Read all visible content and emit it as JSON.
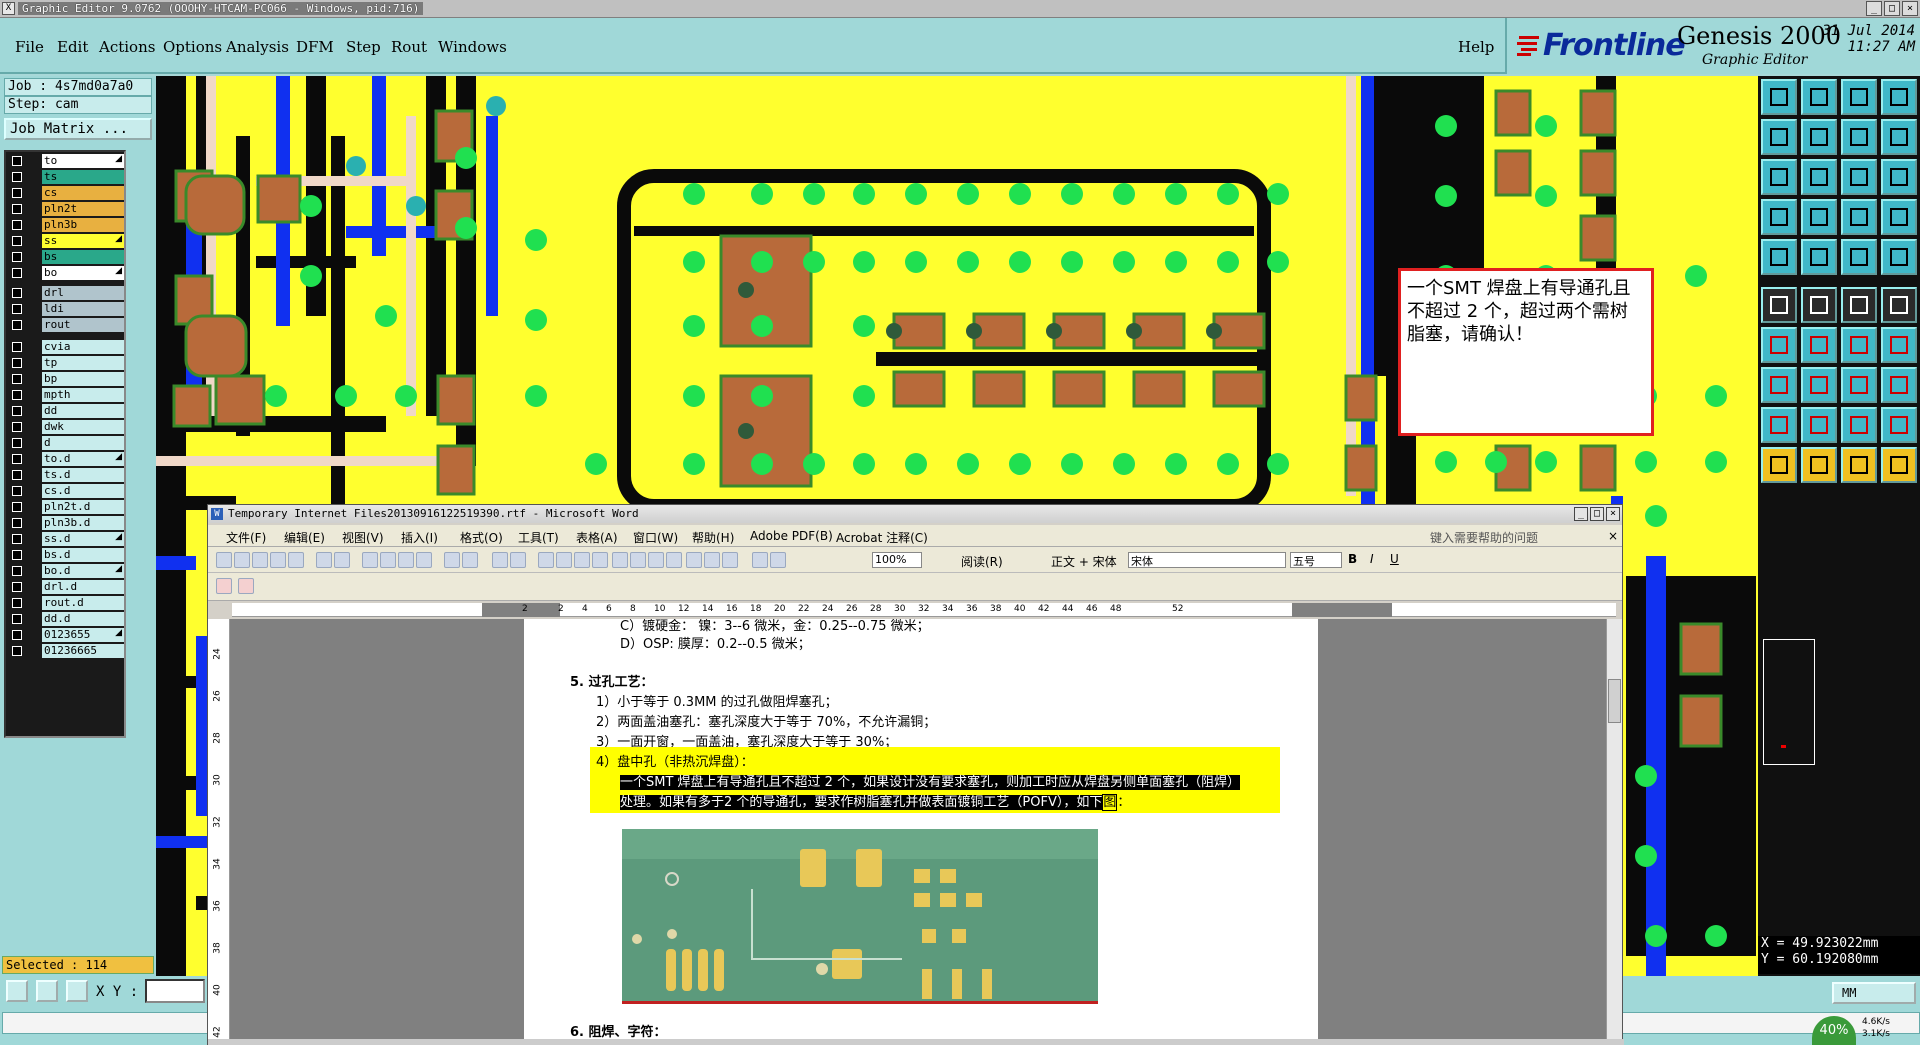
{
  "titlebar": {
    "title": "Graphic Editor 9.0762 (OOOHY-HTCAM-PC066 - Windows, pid:716)"
  },
  "menu": {
    "items": [
      {
        "label": "File",
        "u": "F"
      },
      {
        "label": "Edit",
        "u": "E"
      },
      {
        "label": "Actions",
        "u": "A"
      },
      {
        "label": "Options",
        "u": "O"
      },
      {
        "label": "Analysis",
        "u": "A"
      },
      {
        "label": "DFM",
        "u": "D"
      },
      {
        "label": "Step",
        "u": "S"
      },
      {
        "label": "Rout",
        "u": "R"
      },
      {
        "label": "Windows",
        "u": "W"
      }
    ],
    "help": "Help"
  },
  "brand": {
    "logo": "Frontline",
    "product": "Genesis 2000",
    "subtitle": "Graphic Editor",
    "date": "31 Jul 2014",
    "time": "11:27 AM"
  },
  "job": {
    "job_label": "Job : 4s7md0a7a0",
    "step_label": "Step: cam",
    "matrix_button": "Job Matrix ...",
    "selected": "Selected : 114"
  },
  "layers": [
    {
      "name": "to",
      "color": "#ffffff",
      "arrow": true
    },
    {
      "name": "ts",
      "color": "#2aa88a",
      "arrow": false
    },
    {
      "name": "cs",
      "color": "#e8b040",
      "arrow": false
    },
    {
      "name": "pln2t",
      "color": "#e8b040",
      "arrow": false
    },
    {
      "name": "pln3b",
      "color": "#e8b040",
      "arrow": false
    },
    {
      "name": "ss",
      "color": "#ffff30",
      "arrow": true
    },
    {
      "name": "bs",
      "color": "#2aa88a",
      "arrow": false
    },
    {
      "name": "bo",
      "color": "#ffffff",
      "arrow": true
    },
    {
      "name": "drl",
      "color": "#b0c4cc",
      "arrow": false
    },
    {
      "name": "ldi",
      "color": "#b0c4cc",
      "arrow": false
    },
    {
      "name": "rout",
      "color": "#b0c4cc",
      "arrow": false
    },
    {
      "name": "cvia",
      "color": "#c8ecec",
      "arrow": false
    },
    {
      "name": "tp",
      "color": "#c8ecec",
      "arrow": false
    },
    {
      "name": "bp",
      "color": "#c8ecec",
      "arrow": false
    },
    {
      "name": "mpth",
      "color": "#c8ecec",
      "arrow": false
    },
    {
      "name": "dd",
      "color": "#c8ecec",
      "arrow": false
    },
    {
      "name": "dwk",
      "color": "#c8ecec",
      "arrow": false
    },
    {
      "name": "d",
      "color": "#c8ecec",
      "arrow": false
    },
    {
      "name": "to.d",
      "color": "#c8ecec",
      "arrow": true
    },
    {
      "name": "ts.d",
      "color": "#c8ecec",
      "arrow": false
    },
    {
      "name": "cs.d",
      "color": "#c8ecec",
      "arrow": false
    },
    {
      "name": "pln2t.d",
      "color": "#c8ecec",
      "arrow": false
    },
    {
      "name": "pln3b.d",
      "color": "#c8ecec",
      "arrow": false
    },
    {
      "name": "ss.d",
      "color": "#c8ecec",
      "arrow": true
    },
    {
      "name": "bs.d",
      "color": "#c8ecec",
      "arrow": false
    },
    {
      "name": "bo.d",
      "color": "#c8ecec",
      "arrow": true
    },
    {
      "name": "drl.d",
      "color": "#c8ecec",
      "arrow": false
    },
    {
      "name": "rout.d",
      "color": "#c8ecec",
      "arrow": false
    },
    {
      "name": "dd.d",
      "color": "#c8ecec",
      "arrow": false
    },
    {
      "name": "0123655",
      "color": "#c8ecec",
      "arrow": true
    },
    {
      "name": "01236665",
      "color": "#c8ecec",
      "arrow": false
    }
  ],
  "callout": {
    "text": "一个SMT 焊盘上有导通孔且不超过 2 个，超过两个需树脂塞，请确认！"
  },
  "coords": {
    "x": "X  =  49.923022mm",
    "y": "Y  =  60.192080mm"
  },
  "bottom": {
    "xy_label": "X Y :",
    "units": "MM",
    "zoom_pct": "40%",
    "speed_up": "4.6K/s",
    "speed_down": "3.1K/s"
  },
  "word": {
    "title": "Temporary Internet Files20130916122519390.rtf - Microsoft Word",
    "menus": [
      "文件(F)",
      "编辑(E)",
      "视图(V)",
      "插入(I)",
      "格式(O)",
      "工具(T)",
      "表格(A)",
      "窗口(W)",
      "帮助(H)",
      "Adobe PDF(B)",
      "Acrobat 注释(C)"
    ],
    "help_placeholder": "键入需要帮助的问题",
    "zoom": "100%",
    "read_btn": "阅读(R)",
    "style": "正文 + 宋体",
    "font": "宋体",
    "size": "五号",
    "ruler_ticks": [
      "2",
      "2",
      "4",
      "6",
      "8",
      "10",
      "12",
      "14",
      "16",
      "18",
      "20",
      "22",
      "24",
      "26",
      "28",
      "30",
      "32",
      "34",
      "36",
      "38",
      "40",
      "42",
      "44",
      "46",
      "48",
      "52"
    ],
    "vruler_ticks": [
      "24",
      "26",
      "28",
      "30",
      "32",
      "34",
      "36",
      "38",
      "40",
      "42"
    ],
    "lines": {
      "l0": "C）镀硬金：    镍：3--6 微米，金：0.25--0.75 微米；",
      "l1": "D）OSP:       膜厚：0.2--0.5 微米；",
      "h5": "5.   过孔工艺：",
      "p1": "1）小于等于 0.3MM 的过孔做阻焊塞孔；",
      "p2": "2）两面盖油塞孔：塞孔深度大于等于 70%，不允许漏铜；",
      "p3": "3）一面开窗，一面盖油，塞孔深度大于等于 30%；",
      "p4": "4）盘中孔（非热沉焊盘）：",
      "sel1": "一个SMT 焊盘上有导通孔且不超过 2 个，如果设计没有要求塞孔，则加工时应从焊盘另侧单面塞孔（阻焊）",
      "sel2a": "处理。如果有多于2 个的导通孔，要求作树脂塞孔并做表面镀铜工艺（POFV），如下",
      "sel2b": "图",
      "sel2c": "：",
      "h6": "6.   阻焊、字符："
    }
  }
}
